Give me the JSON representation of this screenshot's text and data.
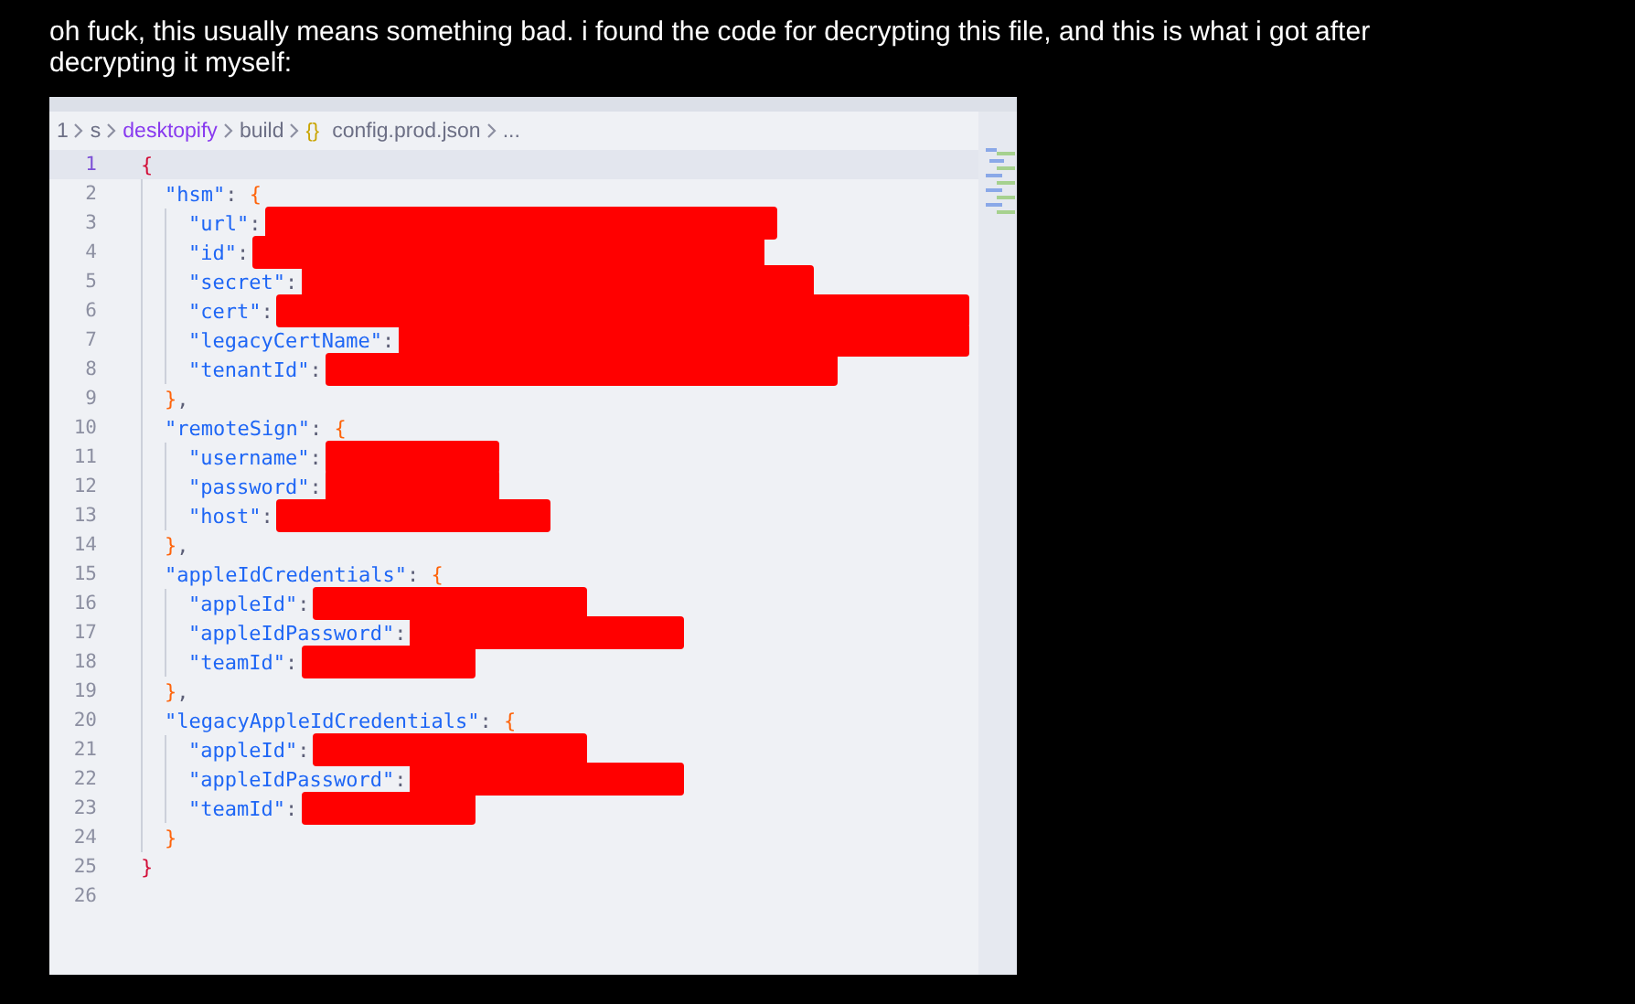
{
  "post": {
    "text": "oh fuck, this usually means something bad. i found the code for decrypting this file, and this is what i got after decrypting it myself:"
  },
  "editor": {
    "breadcrumb": [
      {
        "text": "1",
        "kind": "plain"
      },
      {
        "text": "s",
        "kind": "plain"
      },
      {
        "text": "desktopify",
        "kind": "accent"
      },
      {
        "text": "build",
        "kind": "plain"
      },
      {
        "text": "config.prod.json",
        "kind": "file",
        "icon": "{}"
      },
      {
        "text": "...",
        "kind": "plain"
      }
    ],
    "lines": [
      {
        "number": "1",
        "current": true,
        "tokens": [
          {
            "kind": "outer",
            "text": "{"
          }
        ],
        "children": [
          {
            "number": "2",
            "current": false,
            "tokens": [
              {
                "kind": "key",
                "text": "\"hsm\""
              },
              {
                "kind": "punct",
                "text": ": "
              },
              {
                "kind": "brace",
                "text": "{"
              }
            ],
            "children": [
              {
                "number": "3",
                "current": false,
                "tokens": [
                  {
                    "kind": "key",
                    "text": "\"url\""
                  },
                  {
                    "kind": "punct",
                    "text": ":"
                  }
                ],
                "redaction": {
                  "kind": "long"
                }
              },
              {
                "number": "4",
                "current": false,
                "tokens": [
                  {
                    "kind": "key",
                    "text": "\"id\""
                  },
                  {
                    "kind": "punct",
                    "text": ":"
                  }
                ],
                "redaction": {
                  "kind": "long"
                }
              },
              {
                "number": "5",
                "current": false,
                "tokens": [
                  {
                    "kind": "key",
                    "text": "\"secret\""
                  },
                  {
                    "kind": "punct",
                    "text": ":"
                  }
                ],
                "redaction": {
                  "kind": "long"
                }
              },
              {
                "number": "6",
                "current": false,
                "tokens": [
                  {
                    "kind": "key",
                    "text": "\"cert\""
                  },
                  {
                    "kind": "punct",
                    "text": ":"
                  }
                ],
                "redaction": {
                  "kind": "full"
                }
              },
              {
                "number": "7",
                "current": false,
                "tokens": [
                  {
                    "kind": "key",
                    "text": "\"legacyCertName\""
                  },
                  {
                    "kind": "punct",
                    "text": ":"
                  }
                ],
                "redaction": {
                  "kind": "full"
                }
              },
              {
                "number": "8",
                "current": false,
                "tokens": [
                  {
                    "kind": "key",
                    "text": "\"tenantId\""
                  },
                  {
                    "kind": "punct",
                    "text": ":"
                  }
                ],
                "redaction": {
                  "kind": "long"
                }
              }
            ]
          },
          {
            "number": "9",
            "current": false,
            "tokens": [
              {
                "kind": "brace",
                "text": "}"
              },
              {
                "kind": "punct",
                "text": ","
              }
            ]
          },
          {
            "number": "10",
            "current": false,
            "tokens": [
              {
                "kind": "key",
                "text": "\"remoteSign\""
              },
              {
                "kind": "punct",
                "text": ": "
              },
              {
                "kind": "brace",
                "text": "{"
              }
            ],
            "children": [
              {
                "number": "11",
                "current": false,
                "tokens": [
                  {
                    "kind": "key",
                    "text": "\"username\""
                  },
                  {
                    "kind": "punct",
                    "text": ":"
                  }
                ],
                "redaction": {
                  "kind": "short"
                }
              },
              {
                "number": "12",
                "current": false,
                "tokens": [
                  {
                    "kind": "key",
                    "text": "\"password\""
                  },
                  {
                    "kind": "punct",
                    "text": ":"
                  }
                ],
                "redaction": {
                  "kind": "short"
                }
              },
              {
                "number": "13",
                "current": false,
                "tokens": [
                  {
                    "kind": "key",
                    "text": "\"host\""
                  },
                  {
                    "kind": "punct",
                    "text": ":"
                  }
                ],
                "redaction": {
                  "kind": "medium"
                }
              }
            ]
          },
          {
            "number": "14",
            "current": false,
            "tokens": [
              {
                "kind": "brace",
                "text": "}"
              },
              {
                "kind": "punct",
                "text": ","
              }
            ]
          },
          {
            "number": "15",
            "current": false,
            "tokens": [
              {
                "kind": "key",
                "text": "\"appleIdCredentials\""
              },
              {
                "kind": "punct",
                "text": ": "
              },
              {
                "kind": "brace",
                "text": "{"
              }
            ],
            "children": [
              {
                "number": "16",
                "current": false,
                "tokens": [
                  {
                    "kind": "key",
                    "text": "\"appleId\""
                  },
                  {
                    "kind": "punct",
                    "text": ":"
                  }
                ],
                "redaction": {
                  "kind": "medium"
                }
              },
              {
                "number": "17",
                "current": false,
                "tokens": [
                  {
                    "kind": "key",
                    "text": "\"appleIdPassword\""
                  },
                  {
                    "kind": "punct",
                    "text": ":"
                  }
                ],
                "redaction": {
                  "kind": "medium"
                }
              },
              {
                "number": "18",
                "current": false,
                "tokens": [
                  {
                    "kind": "key",
                    "text": "\"teamId\""
                  },
                  {
                    "kind": "punct",
                    "text": ":"
                  }
                ],
                "redaction": {
                  "kind": "short"
                }
              }
            ]
          },
          {
            "number": "19",
            "current": false,
            "tokens": [
              {
                "kind": "brace",
                "text": "}"
              },
              {
                "kind": "punct",
                "text": ","
              }
            ]
          },
          {
            "number": "20",
            "current": false,
            "tokens": [
              {
                "kind": "key",
                "text": "\"legacyAppleIdCredentials\""
              },
              {
                "kind": "punct",
                "text": ": "
              },
              {
                "kind": "brace",
                "text": "{"
              }
            ],
            "children": [
              {
                "number": "21",
                "current": false,
                "tokens": [
                  {
                    "kind": "key",
                    "text": "\"appleId\""
                  },
                  {
                    "kind": "punct",
                    "text": ":"
                  }
                ],
                "redaction": {
                  "kind": "medium"
                }
              },
              {
                "number": "22",
                "current": false,
                "tokens": [
                  {
                    "kind": "key",
                    "text": "\"appleIdPassword\""
                  },
                  {
                    "kind": "punct",
                    "text": ":"
                  }
                ],
                "redaction": {
                  "kind": "medium"
                }
              },
              {
                "number": "23",
                "current": false,
                "tokens": [
                  {
                    "kind": "key",
                    "text": "\"teamId\""
                  },
                  {
                    "kind": "punct",
                    "text": ":"
                  }
                ],
                "redaction": {
                  "kind": "short"
                }
              }
            ]
          },
          {
            "number": "24",
            "current": false,
            "tokens": [
              {
                "kind": "brace",
                "text": "}"
              }
            ]
          }
        ]
      },
      {
        "number": "25",
        "current": false,
        "tokens": [
          {
            "kind": "outer",
            "text": "}"
          }
        ]
      },
      {
        "number": "26",
        "current": false
      }
    ]
  }
}
